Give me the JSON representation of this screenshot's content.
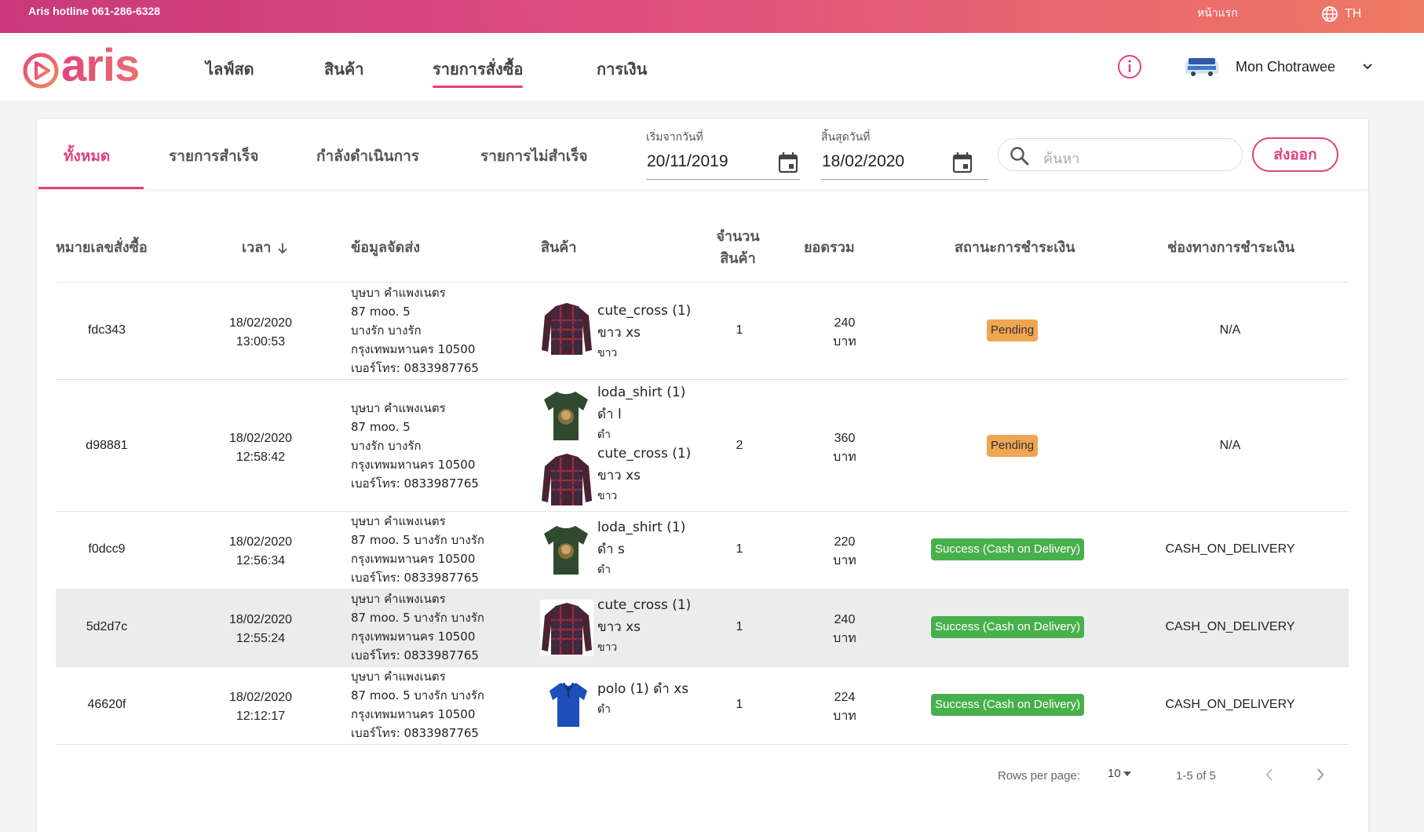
{
  "topbar": {
    "hotline": "Aris hotline 061-286-6328",
    "home": "หน้าแรก",
    "lang": "TH",
    "lang_icon": "globe-icon"
  },
  "brand": {
    "logo_text": "aris",
    "logo_icon": "play-circle-icon",
    "accent": "#e2407f"
  },
  "nav": {
    "items": [
      "ไลฟ์สด",
      "สินค้า",
      "รายการสั่งซื้อ",
      "การเงิน"
    ],
    "active": "รายการสั่งซื้อ",
    "user_name": "Mon Chotrawee"
  },
  "filters": {
    "tabs": [
      "ทั้งหมด",
      "รายการสำเร็จ",
      "กำลังดำเนินการ",
      "รายการไม่สำเร็จ"
    ],
    "active_tab": "ทั้งหมด",
    "start_label": "เริ่มจากวันที่",
    "start_value": "20/11/2019",
    "end_label": "สิ้นสุดวันที่",
    "end_value": "18/02/2020",
    "search_placeholder": "ค้นหา",
    "export_label": "ส่งออก"
  },
  "table": {
    "headers": {
      "order_id": "หมายเลขสั่งซื้อ",
      "time": "เวลา",
      "shipping": "ข้อมูลจัดส่ง",
      "product": "สินค้า",
      "qty_line1": "จำนวน",
      "qty_line2": "สินค้า",
      "total": "ยอดรวม",
      "pay_status": "สถานะการชำระเงิน",
      "pay_channel": "ช่องทางการชำระเงิน"
    },
    "sort_icon": "arrow-down-icon",
    "rows": [
      {
        "id": "fdc343",
        "date": "18/02/2020",
        "time": "13:00:53",
        "ship": [
          "บุษบา คำแพงเนตร",
          "87 moo. 5",
          "บางรัก บางรัก",
          "กรุงเทพมหานคร 10500",
          "เบอร์โทร: 0833987765"
        ],
        "products": [
          {
            "name": "cute_cross (1)",
            "variant": "ขาว xs",
            "color": "ขาว",
            "image": "plaid-shirt"
          }
        ],
        "qty": "1",
        "total": "240",
        "currency": "บาท",
        "status": "Pending",
        "status_type": "pending",
        "channel": "N/A"
      },
      {
        "id": "d98881",
        "date": "18/02/2020",
        "time": "12:58:42",
        "ship": [
          "บุษบา คำแพงเนตร",
          "87 moo. 5",
          "บางรัก บางรัก",
          "กรุงเทพมหานคร 10500",
          "เบอร์โทร: 0833987765"
        ],
        "products": [
          {
            "name": "loda_shirt (1)",
            "variant": "ดำ l",
            "color": "ดำ",
            "image": "green-tshirt"
          },
          {
            "name": "cute_cross (1)",
            "variant": "ขาว xs",
            "color": "ขาว",
            "image": "plaid-shirt"
          }
        ],
        "qty": "2",
        "total": "360",
        "currency": "บาท",
        "status": "Pending",
        "status_type": "pending",
        "channel": "N/A"
      },
      {
        "id": "f0dcc9",
        "date": "18/02/2020",
        "time": "12:56:34",
        "ship": [
          "บุษบา คำแพงเนตร",
          "87 moo. 5 บางรัก บางรัก",
          "กรุงเทพมหานคร 10500",
          "เบอร์โทร: 0833987765"
        ],
        "products": [
          {
            "name": "loda_shirt (1)",
            "variant": "ดำ s",
            "color": "ดำ",
            "image": "green-tshirt"
          }
        ],
        "qty": "1",
        "total": "220",
        "currency": "บาท",
        "status": "Success (Cash on Delivery)",
        "status_type": "success",
        "channel": "CASH_ON_DELIVERY"
      },
      {
        "id": "5d2d7c",
        "date": "18/02/2020",
        "time": "12:55:24",
        "ship": [
          "บุษบา คำแพงเนตร",
          "87 moo. 5 บางรัก บางรัก",
          "กรุงเทพมหานคร 10500",
          "เบอร์โทร: 0833987765"
        ],
        "products": [
          {
            "name": "cute_cross (1)",
            "variant": "ขาว xs",
            "color": "ขาว",
            "image": "plaid-shirt"
          }
        ],
        "qty": "1",
        "total": "240",
        "currency": "บาท",
        "status": "Success (Cash on Delivery)",
        "status_type": "success",
        "channel": "CASH_ON_DELIVERY"
      },
      {
        "id": "46620f",
        "date": "18/02/2020",
        "time": "12:12:17",
        "ship": [
          "บุษบา คำแพงเนตร",
          "87 moo. 5 บางรัก บางรัก",
          "กรุงเทพมหานคร 10500",
          "เบอร์โทร: 0833987765"
        ],
        "products": [
          {
            "name": "polo (1) ดำ xs",
            "variant": "",
            "color": "ดำ",
            "image": "blue-polo"
          }
        ],
        "qty": "1",
        "total": "224",
        "currency": "บาท",
        "status": "Success (Cash on Delivery)",
        "status_type": "success",
        "channel": "CASH_ON_DELIVERY"
      }
    ]
  },
  "pagination": {
    "rows_label": "Rows per page:",
    "rows_value": "10",
    "range": "1-5 of 5",
    "prev_icon": "chevron-left-icon",
    "next_icon": "chevron-right-icon"
  },
  "colors": {
    "pending": "#f0a552",
    "success": "#47b04c",
    "highlight_row": "#ececec"
  }
}
